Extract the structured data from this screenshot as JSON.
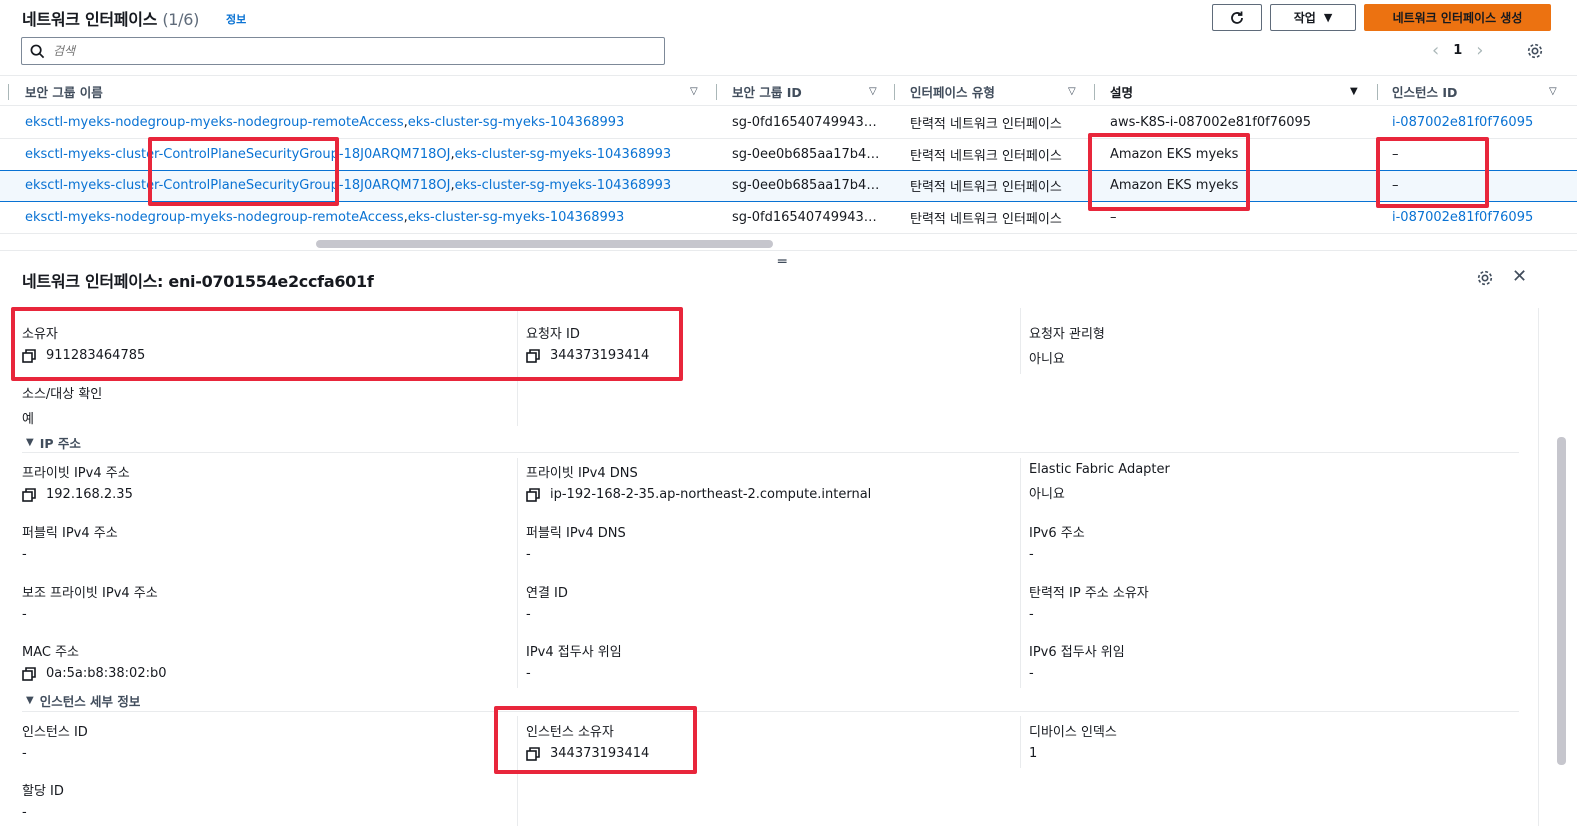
{
  "header": {
    "title": "네트워크 인터페이스",
    "count": "(1/6)",
    "info_label": "정보",
    "actions_label": "작업",
    "create_label": "네트워크 인터페이스 생성",
    "search_placeholder": "검색",
    "page_number": "1"
  },
  "table": {
    "columns": [
      "보안 그룹 이름",
      "보안 그룹 ID",
      "인터페이스 유형",
      "설명",
      "인스턴스 ID"
    ],
    "rows": [
      {
        "sg_name_1": "eksctl-myeks-nodegroup-myeks-nodegroup-remoteAccess",
        "sep": ", ",
        "sg_name_2": "eks-cluster-sg-myeks-104368993",
        "sg_id": "sg-0fd16540749943…",
        "type": "탄력적 네트워크 인터페이스",
        "description": "aws-K8S-i-087002e81f0f76095",
        "instance_id": "i-087002e81f0f76095"
      },
      {
        "sg_name_1": "eksctl-myeks-cluster-ControlPlaneSecurityGroup-18J0ARQM718OJ",
        "sep": ", ",
        "sg_name_2": "eks-cluster-sg-myeks-104368993",
        "sg_id": "sg-0ee0b685aa17b4…",
        "type": "탄력적 네트워크 인터페이스",
        "description": "Amazon EKS myeks",
        "instance_id": "–"
      },
      {
        "sg_name_1": "eksctl-myeks-cluster-ControlPlaneSecurityGroup-18J0ARQM718OJ",
        "sep": ", ",
        "sg_name_2": "eks-cluster-sg-myeks-104368993",
        "sg_id": "sg-0ee0b685aa17b4…",
        "type": "탄력적 네트워크 인터페이스",
        "description": "Amazon EKS myeks",
        "instance_id": "–"
      },
      {
        "sg_name_1": "eksctl-myeks-nodegroup-myeks-nodegroup-remoteAccess",
        "sep": ", ",
        "sg_name_2": "eks-cluster-sg-myeks-104368993",
        "sg_id": "sg-0fd16540749943…",
        "type": "탄력적 네트워크 인터페이스",
        "description": "–",
        "instance_id": "i-087002e81f0f76095"
      }
    ]
  },
  "detail": {
    "title": "네트워크 인터페이스: eni-0701554e2ccfa601f",
    "owner_label": "소유자",
    "owner_value": "911283464785",
    "requester_id_label": "요청자 ID",
    "requester_id_value": "344373193414",
    "requester_managed_label": "요청자 관리형",
    "requester_managed_value": "아니요",
    "src_dst_check_label": "소스/대상 확인",
    "src_dst_check_value": "예",
    "ip_section_label": "IP 주소",
    "private_ipv4_label": "프라이빗 IPv4 주소",
    "private_ipv4_value": "192.168.2.35",
    "private_ipv4_dns_label": "프라이빗 IPv4 DNS",
    "private_ipv4_dns_value": "ip-192-168-2-35.ap-northeast-2.compute.internal",
    "efa_label": "Elastic Fabric Adapter",
    "efa_value": "아니요",
    "public_ipv4_label": "퍼블릭 IPv4 주소",
    "public_ipv4_value": "-",
    "public_ipv4_dns_label": "퍼블릭 IPv4 DNS",
    "public_ipv4_dns_value": "-",
    "ipv6_label": "IPv6 주소",
    "ipv6_value": "-",
    "secondary_ipv4_label": "보조 프라이빗 IPv4 주소",
    "secondary_ipv4_value": "-",
    "association_id_label": "연결 ID",
    "association_id_value": "-",
    "eip_owner_label": "탄력적 IP 주소 소유자",
    "eip_owner_value": "-",
    "mac_label": "MAC 주소",
    "mac_value": "0a:5a:b8:38:02:b0",
    "ipv4_prefix_label": "IPv4 접두사 위임",
    "ipv4_prefix_value": "-",
    "ipv6_prefix_label": "IPv6 접두사 위임",
    "ipv6_prefix_value": "-",
    "instance_section_label": "인스턴스 세부 정보",
    "instance_id_label": "인스턴스 ID",
    "instance_id_value": "-",
    "instance_owner_label": "인스턴스 소유자",
    "instance_owner_value": "344373193414",
    "device_index_label": "디바이스 인덱스",
    "device_index_value": "1",
    "attachment_id_label": "할당 ID",
    "attachment_id_value": "-"
  },
  "colors": {
    "link": "#0972d3",
    "primary_button": "#ec7211",
    "highlight": "#e8263b",
    "selected_row": "#f2f8fd"
  },
  "icons": [
    "refresh-icon",
    "caret-down-icon",
    "search-icon",
    "chevron-left-icon",
    "chevron-right-icon",
    "gear-icon",
    "sort-icon",
    "drag-handle-icon",
    "close-icon",
    "copy-icon",
    "triangle-down-icon"
  ]
}
